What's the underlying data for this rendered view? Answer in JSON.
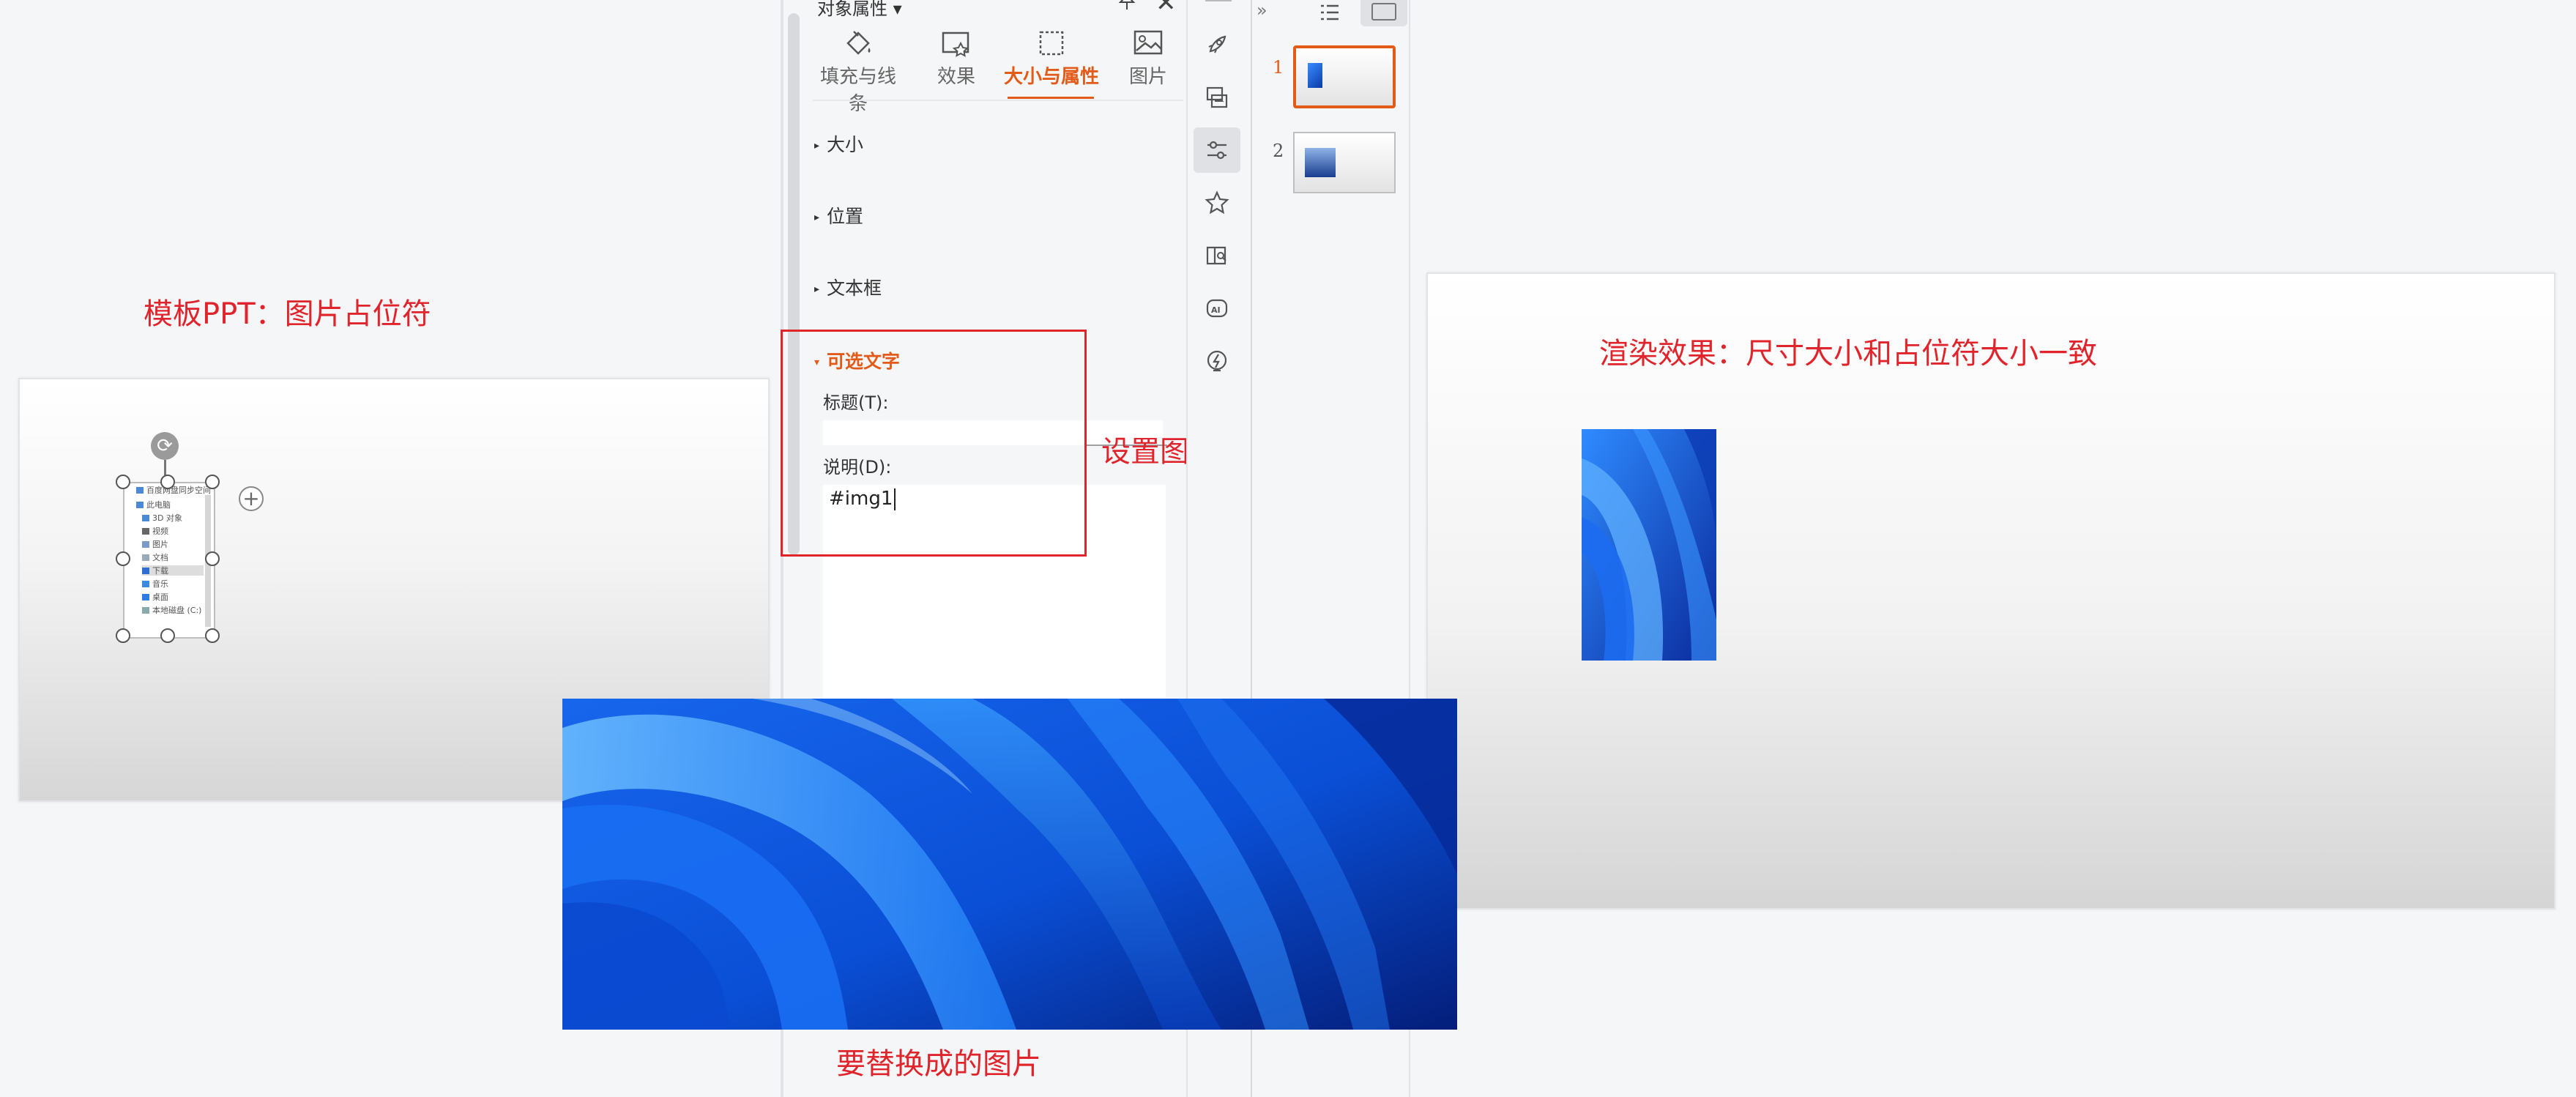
{
  "annotations": {
    "template_label": "模板PPT：图片占位符",
    "datasource_label": "设置图片数据源",
    "replace_label": "要替换成的图片",
    "render_label": "渲染效果：尺寸大小和占位符大小一致"
  },
  "pane": {
    "title": "对象属性 ▾",
    "tabs": [
      {
        "label": "填充与线条",
        "icon": "fill-bucket-icon",
        "active": false
      },
      {
        "label": "效果",
        "icon": "effect-icon",
        "active": false
      },
      {
        "label": "大小与属性",
        "icon": "size-properties-icon",
        "active": true
      },
      {
        "label": "图片",
        "icon": "picture-icon",
        "active": false
      }
    ],
    "sections": {
      "size": "大小",
      "position": "位置",
      "textbox": "文本框",
      "alt_text": "可选文字"
    },
    "fields": {
      "title_label": "标题(T):",
      "title_value": "",
      "desc_label": "说明(D):",
      "desc_value": "#img1"
    }
  },
  "placeholder_tree": {
    "items": [
      "百度网盘同步空间",
      "此电脑",
      "3D 对象",
      "视频",
      "图片",
      "文档",
      "下载",
      "音乐",
      "桌面",
      "本地磁盘 (C:)"
    ]
  },
  "thumbnails": {
    "toggle": "»",
    "slides": [
      {
        "num": "1",
        "selected": true
      },
      {
        "num": "2",
        "selected": false
      }
    ]
  },
  "toolbar": {
    "icons": [
      "rocket-icon",
      "convert-icon",
      "properties-icon",
      "star-icon",
      "book-search-icon",
      "ai-icon",
      "lightning-icon"
    ]
  },
  "colors": {
    "accent": "#e35b18",
    "annotation_red": "#e0242b",
    "wallpaper_blue": "#0a5ae8"
  }
}
